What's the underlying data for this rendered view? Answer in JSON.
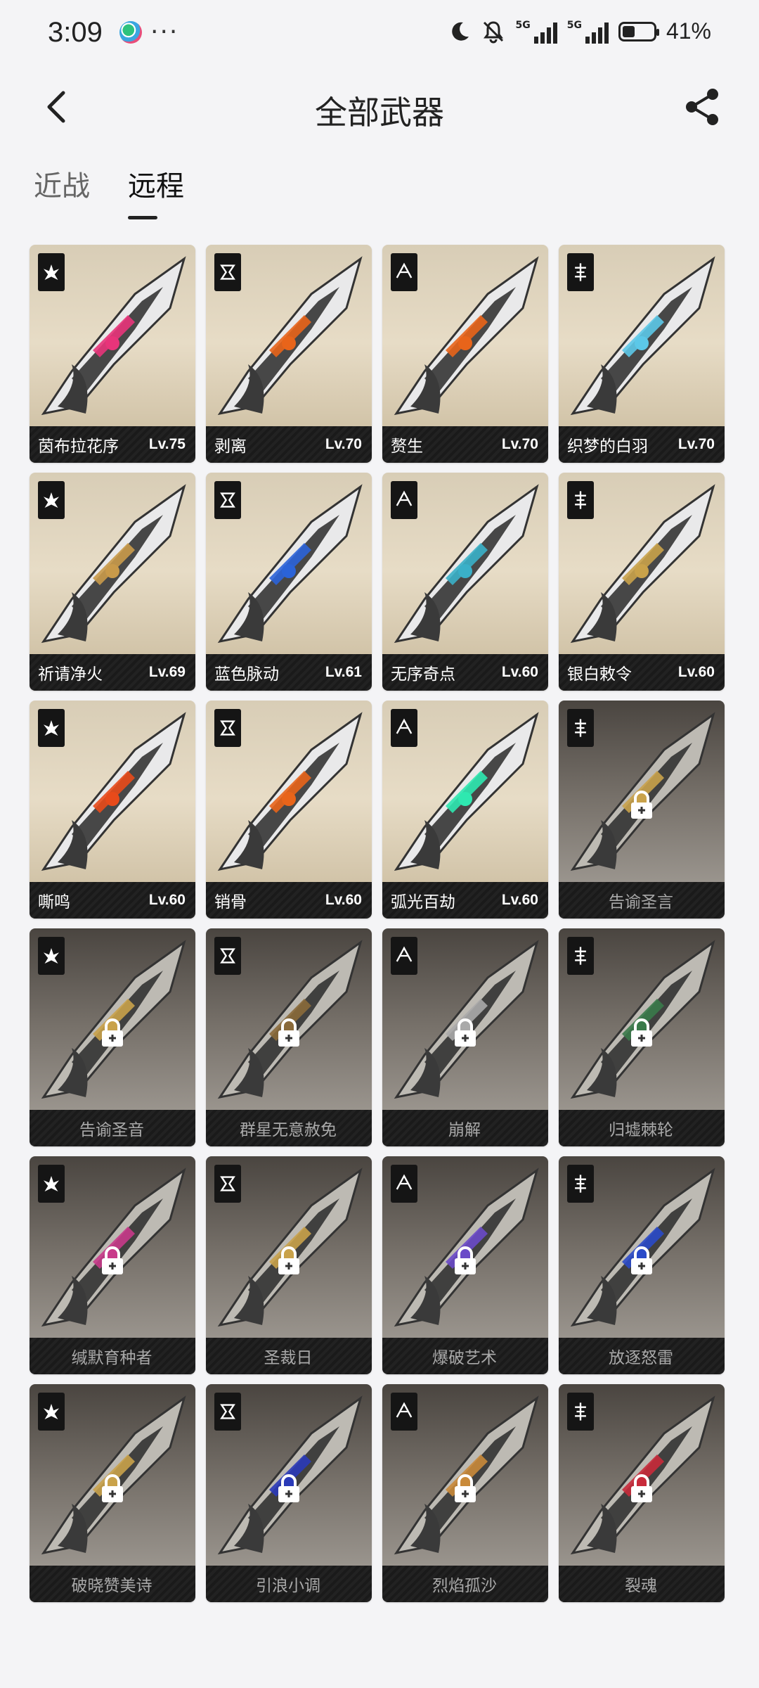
{
  "status_bar": {
    "time": "3:09",
    "network_1": "5G",
    "network_2": "5G",
    "battery_percent": "41%",
    "battery_level": 0.41
  },
  "header": {
    "title": "全部武器",
    "back_icon": "chevron-left-icon",
    "share_icon": "share-icon"
  },
  "tabs": [
    {
      "label": "近战",
      "active": false
    },
    {
      "label": "远程",
      "active": true
    }
  ],
  "colors": {
    "unlocked_card_bg": "#e1d6bf",
    "locked_card_bg": "#77716a",
    "footer_bg": "#1a1a1a"
  },
  "weapons": [
    {
      "name": "茵布拉花序",
      "level": "Lv.75",
      "locked": false,
      "accent": "#e8347a"
    },
    {
      "name": "剥离",
      "level": "Lv.70",
      "locked": false,
      "accent": "#e8641a"
    },
    {
      "name": "赘生",
      "level": "Lv.70",
      "locked": false,
      "accent": "#e8641a"
    },
    {
      "name": "织梦的白羽",
      "level": "Lv.70",
      "locked": false,
      "accent": "#5cc8e8"
    },
    {
      "name": "祈请净火",
      "level": "Lv.69",
      "locked": false,
      "accent": "#c99a4a"
    },
    {
      "name": "蓝色脉动",
      "level": "Lv.61",
      "locked": false,
      "accent": "#2b63d8"
    },
    {
      "name": "无序奇点",
      "level": "Lv.60",
      "locked": false,
      "accent": "#3ab0c8"
    },
    {
      "name": "银白敕令",
      "level": "Lv.60",
      "locked": false,
      "accent": "#c9a24a"
    },
    {
      "name": "嘶鸣",
      "level": "Lv.60",
      "locked": false,
      "accent": "#e84a1a"
    },
    {
      "name": "销骨",
      "level": "Lv.60",
      "locked": false,
      "accent": "#e8641a"
    },
    {
      "name": "弧光百劫",
      "level": "Lv.60",
      "locked": false,
      "accent": "#2ee8b0"
    },
    {
      "name": "告谕圣言",
      "level": "",
      "locked": true,
      "accent": "#c9a24a"
    },
    {
      "name": "告谕圣音",
      "level": "",
      "locked": true,
      "accent": "#c9a24a"
    },
    {
      "name": "群星无意赦免",
      "level": "",
      "locked": true,
      "accent": "#8a6a3a"
    },
    {
      "name": "崩解",
      "level": "",
      "locked": true,
      "accent": "#aaaaaa"
    },
    {
      "name": "归墟棘轮",
      "level": "",
      "locked": true,
      "accent": "#3a7a4a"
    },
    {
      "name": "缄默育种者",
      "level": "",
      "locked": true,
      "accent": "#c83a8a"
    },
    {
      "name": "圣裁日",
      "level": "",
      "locked": true,
      "accent": "#c9a24a"
    },
    {
      "name": "爆破艺术",
      "level": "",
      "locked": true,
      "accent": "#6a4ac8"
    },
    {
      "name": "放逐怒雷",
      "level": "",
      "locked": true,
      "accent": "#2a4ac8"
    },
    {
      "name": "破晓赞美诗",
      "level": "",
      "locked": true,
      "accent": "#c9a24a"
    },
    {
      "name": "引浪小调",
      "level": "",
      "locked": true,
      "accent": "#2a3ab8"
    },
    {
      "name": "烈焰孤沙",
      "level": "",
      "locked": true,
      "accent": "#c98a3a"
    },
    {
      "name": "裂魂",
      "level": "",
      "locked": true,
      "accent": "#c82a3a"
    }
  ]
}
